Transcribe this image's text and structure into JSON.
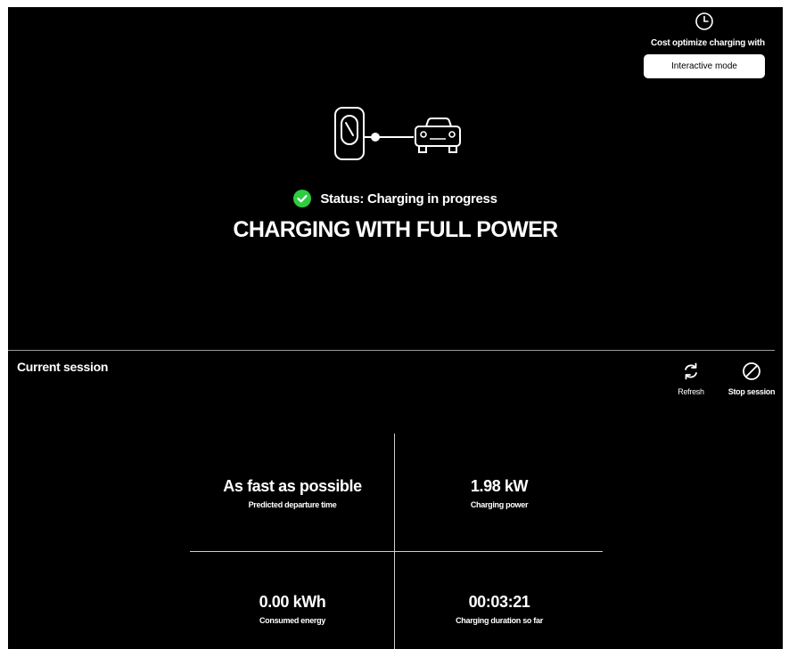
{
  "cost_optimize": {
    "icon": "clock-icon",
    "label": "Cost optimize charging with",
    "mode_button": "Interactive mode"
  },
  "illustration": {
    "charger_icon": "charging-station-icon",
    "car_icon": "car-icon"
  },
  "status": {
    "icon": "check-circle-icon",
    "text": "Status: Charging in progress",
    "headline": "CHARGING WITH FULL POWER",
    "color": "#2ecc40"
  },
  "session": {
    "title": "Current session",
    "actions": {
      "refresh": {
        "icon": "refresh-icon",
        "label": "Refresh"
      },
      "stop": {
        "icon": "stop-icon",
        "label": "Stop session"
      }
    },
    "stats": [
      {
        "value": "As fast as possible",
        "label": "Predicted departure time"
      },
      {
        "value": "1.98 kW",
        "label": "Charging power"
      },
      {
        "value": "0.00 kWh",
        "label": "Consumed energy"
      },
      {
        "value": "00:03:21",
        "label": "Charging duration so far"
      }
    ]
  }
}
